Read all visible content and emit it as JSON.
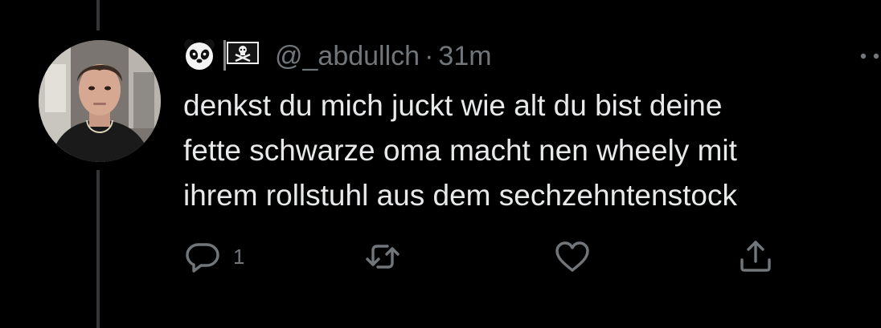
{
  "tweet": {
    "avatar_icon": "profile-photo",
    "name_emojis": [
      "panda-face-icon",
      "pirate-flag-icon"
    ],
    "handle": "@_abdullch",
    "separator": "·",
    "time": "31m",
    "text": "denkst du mich juckt wie alt du bist deine\nfette schwarze oma macht nen wheely mit\nihrem rollstuhl aus dem sechzehntenstock"
  },
  "actions": {
    "reply_count": "1",
    "icons": [
      "reply-icon",
      "retweet-icon",
      "like-icon",
      "share-icon"
    ]
  },
  "colors": {
    "background": "#000000",
    "text": "#e7e9ea",
    "muted": "#71767b",
    "thread_line": "#333639"
  }
}
